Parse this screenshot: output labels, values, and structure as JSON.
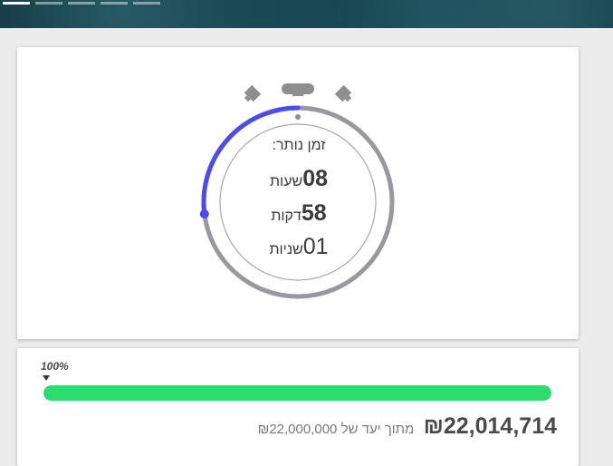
{
  "slider": {
    "dot_count": 5,
    "active_index": 0
  },
  "timer": {
    "label": "זמן נותר:",
    "hours": {
      "value": "08",
      "unit": "שעות"
    },
    "minutes": {
      "value": "58",
      "unit": "דקות"
    },
    "seconds": {
      "value": "01",
      "unit": "שניות"
    },
    "elapsed_fraction": 0.27,
    "colors": {
      "progress_arc": "#4b4bf0",
      "track": "#98989e",
      "inner": "#a0a0a0"
    }
  },
  "campaign": {
    "percent_label": "100%",
    "progress_percent": 100,
    "raised_amount": "₪22,014,714",
    "goal_text": "מתוך יעד של ₪22,000,000",
    "colors": {
      "bar": "#2bdc6e"
    }
  }
}
